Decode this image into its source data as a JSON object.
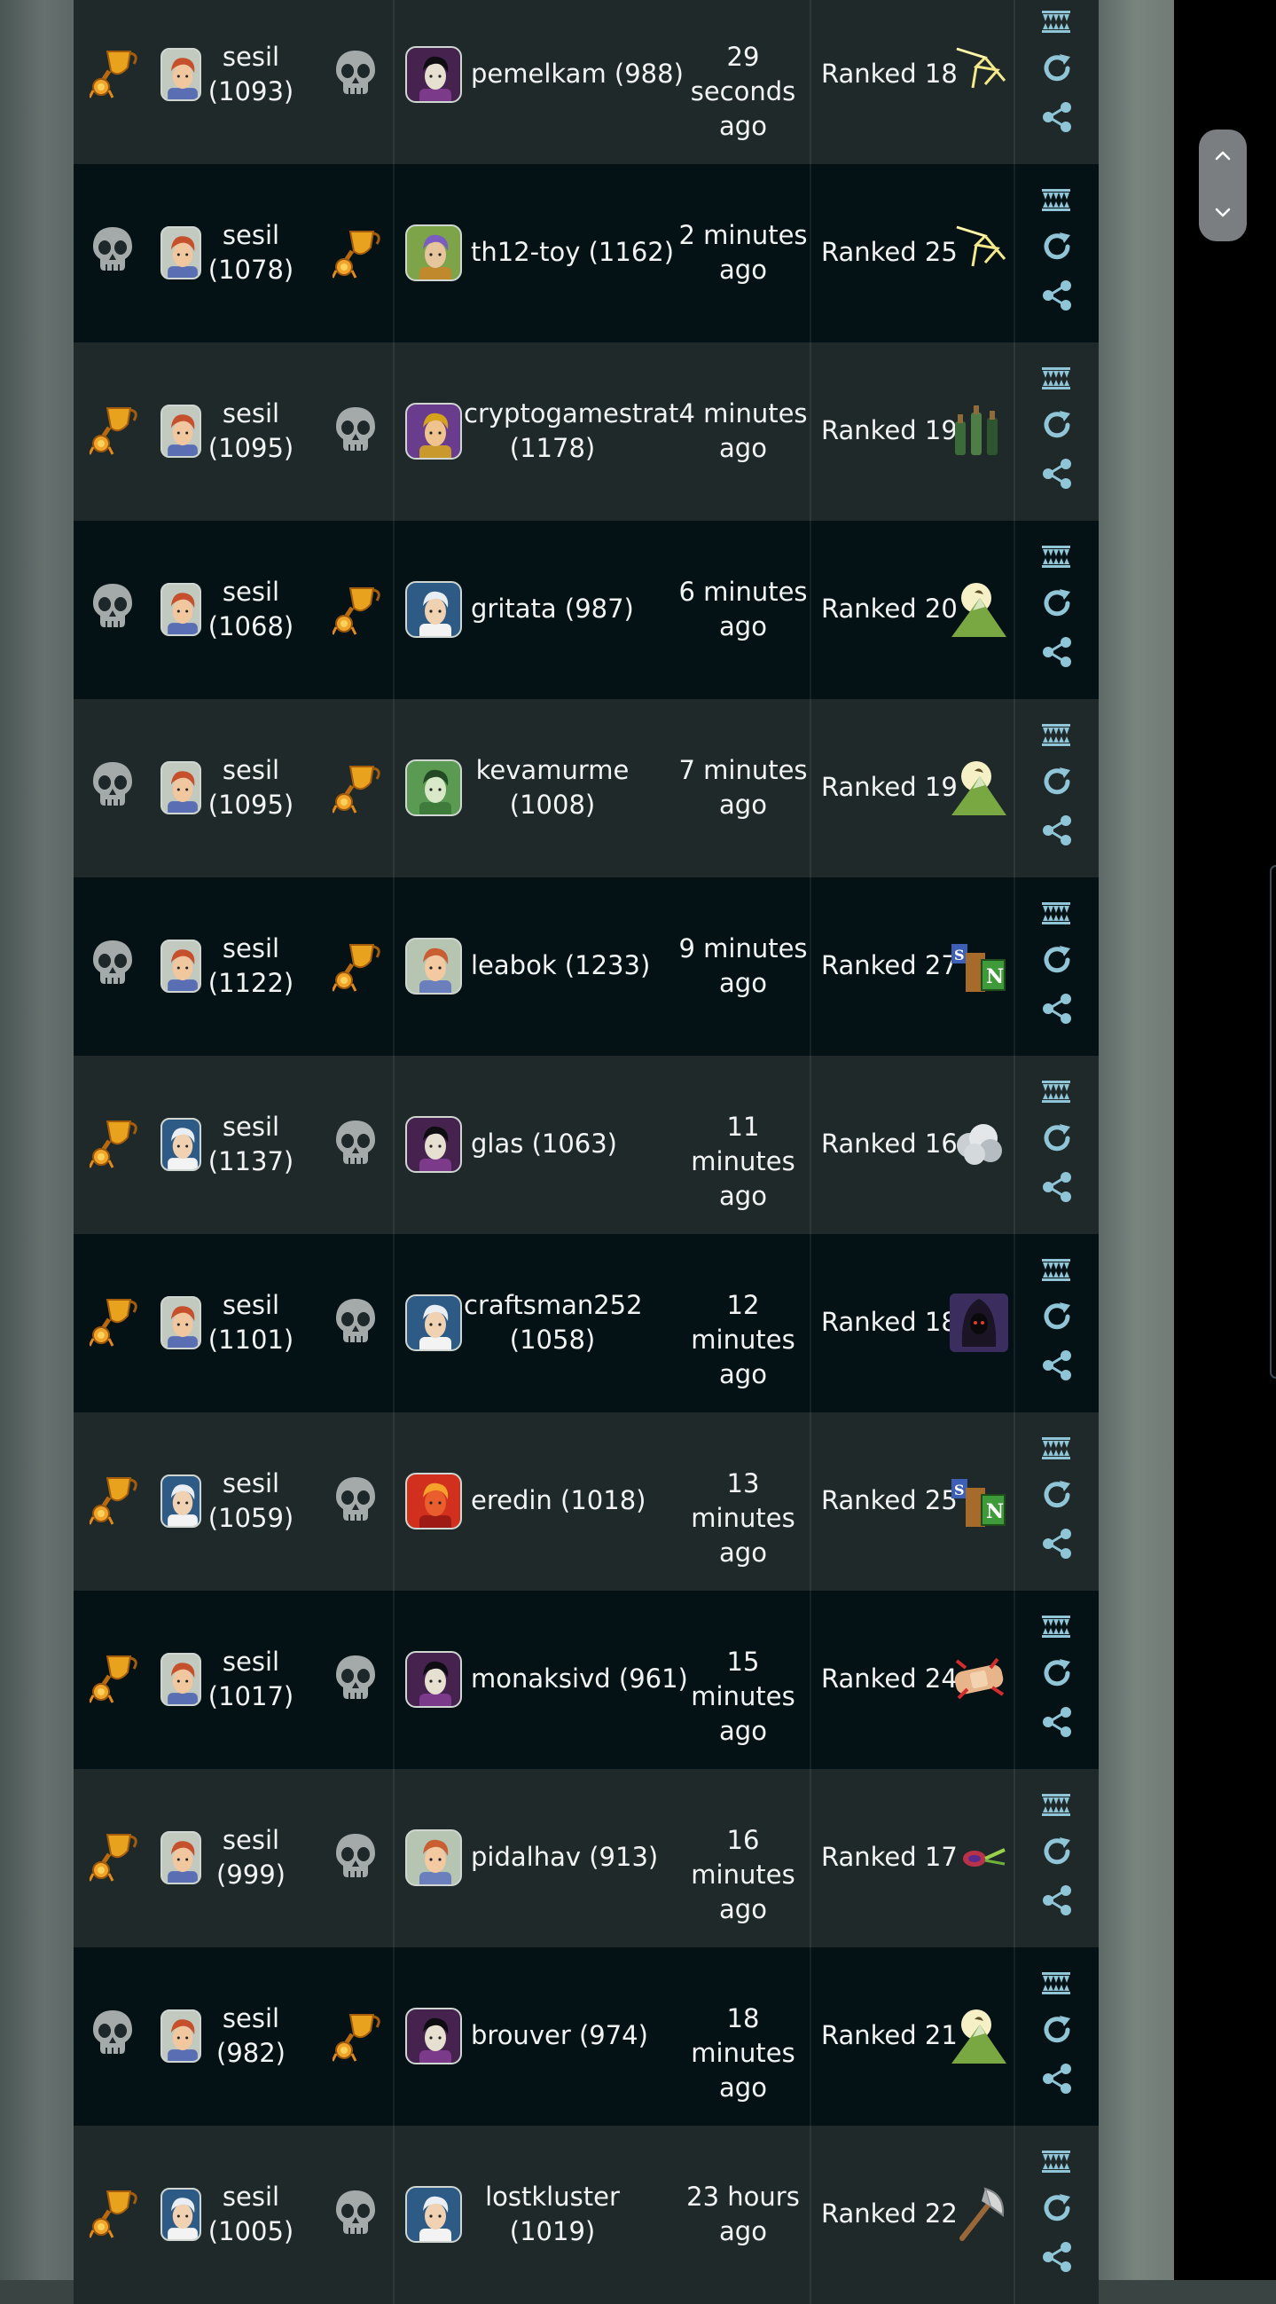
{
  "scroll_controls": {
    "up_icon": "chevron-up-icon",
    "down_icon": "chevron-down-icon"
  },
  "colors": {
    "row_light": "#1f292a",
    "row_dark": "#041216",
    "action_icon": "#8fc5d6",
    "trophy": "#e59b2a",
    "skull": "#9ea3a4"
  },
  "battles": [
    {
      "player_result": "win",
      "player_avatar": "red-hair",
      "player_name": "sesil",
      "player_rating": "(1093)",
      "opp_result": "loss",
      "opp_avatar": "dark-mage",
      "opponent": "pemelkam (988)",
      "time_line1": "29 seconds",
      "time_line2": "ago",
      "rank": "Ranked 18",
      "ruleset": "lightning"
    },
    {
      "player_result": "loss",
      "player_avatar": "red-hair",
      "player_name": "sesil",
      "player_rating": "(1078)",
      "opp_result": "win",
      "opp_avatar": "green-knight",
      "opponent": "th12-toy (1162)",
      "time_line1": "2 minutes",
      "time_line2": "ago",
      "rank": "Ranked 25",
      "ruleset": "lightning"
    },
    {
      "player_result": "win",
      "player_avatar": "red-hair",
      "player_name": "sesil",
      "player_rating": "(1095)",
      "opp_result": "loss",
      "opp_avatar": "gold-warrior",
      "opponent_line1": "cryptogamestrat",
      "opponent_line2": "(1178)",
      "time_line1": "4 minutes",
      "time_line2": "ago",
      "rank": "Ranked 19",
      "ruleset": "bottles"
    },
    {
      "player_result": "loss",
      "player_avatar": "red-hair",
      "player_name": "sesil",
      "player_rating": "(1068)",
      "opp_result": "win",
      "opp_avatar": "wizard",
      "opponent": "gritata (987)",
      "time_line1": "6 minutes",
      "time_line2": "ago",
      "rank": "Ranked 20",
      "ruleset": "moon-mountain"
    },
    {
      "player_result": "loss",
      "player_avatar": "red-hair",
      "player_name": "sesil",
      "player_rating": "(1095)",
      "opp_result": "win",
      "opp_avatar": "green-face",
      "opponent_line1": "kevamurme",
      "opponent_line2": "(1008)",
      "time_line1": "7 minutes",
      "time_line2": "ago",
      "rank": "Ranked 19",
      "ruleset": "moon-mountain"
    },
    {
      "player_result": "loss",
      "player_avatar": "red-hair",
      "player_name": "sesil",
      "player_rating": "(1122)",
      "opp_result": "win",
      "opp_avatar": "red-hair-alt",
      "opponent": "leabok (1233)",
      "time_line1": "9 minutes",
      "time_line2": "ago",
      "rank": "Ranked 27",
      "ruleset": "books"
    },
    {
      "player_result": "win",
      "player_avatar": "wizard",
      "player_name": "sesil",
      "player_rating": "(1137)",
      "opp_result": "loss",
      "opp_avatar": "dark-mage",
      "opponent": "glas (1063)",
      "time_line1": "11 minutes",
      "time_line2": "ago",
      "rank": "Ranked 16",
      "ruleset": "cloud"
    },
    {
      "player_result": "win",
      "player_avatar": "red-hair",
      "player_name": "sesil",
      "player_rating": "(1101)",
      "opp_result": "loss",
      "opp_avatar": "wizard",
      "opponent_line1": "craftsman252",
      "opponent_line2": "(1058)",
      "time_line1": "12 minutes",
      "time_line2": "ago",
      "rank": "Ranked 18",
      "ruleset": "hooded"
    },
    {
      "player_result": "win",
      "player_avatar": "wizard",
      "player_name": "sesil",
      "player_rating": "(1059)",
      "opp_result": "loss",
      "opp_avatar": "fire-dragon",
      "opponent": "eredin (1018)",
      "time_line1": "13 minutes",
      "time_line2": "ago",
      "rank": "Ranked 25",
      "ruleset": "books"
    },
    {
      "player_result": "win",
      "player_avatar": "red-hair",
      "player_name": "sesil",
      "player_rating": "(1017)",
      "opp_result": "loss",
      "opp_avatar": "dark-mage",
      "opponent": "monaksivd (961)",
      "time_line1": "15 minutes",
      "time_line2": "ago",
      "rank": "Ranked 24",
      "ruleset": "bandage"
    },
    {
      "player_result": "win",
      "player_avatar": "red-hair",
      "player_name": "sesil",
      "player_rating": "(999)",
      "opp_result": "loss",
      "opp_avatar": "red-hair-alt",
      "opponent": "pidalhav (913)",
      "time_line1": "16 minutes",
      "time_line2": "ago",
      "rank": "Ranked 17",
      "ruleset": "comet"
    },
    {
      "player_result": "loss",
      "player_avatar": "red-hair",
      "player_name": "sesil",
      "player_rating": "(982)",
      "opp_result": "win",
      "opp_avatar": "dark-mage",
      "opponent": "brouver (974)",
      "time_line1": "18 minutes",
      "time_line2": "ago",
      "rank": "Ranked 21",
      "ruleset": "moon-mountain"
    },
    {
      "player_result": "win",
      "player_avatar": "wizard",
      "player_name": "sesil",
      "player_rating": "(1005)",
      "opp_result": "loss",
      "opp_avatar": "wizard",
      "opponent_line1": "lostkluster",
      "opponent_line2": "(1019)",
      "time_line1": "23 hours",
      "time_line2": "ago",
      "rank": "Ranked 22",
      "ruleset": "axe"
    }
  ]
}
